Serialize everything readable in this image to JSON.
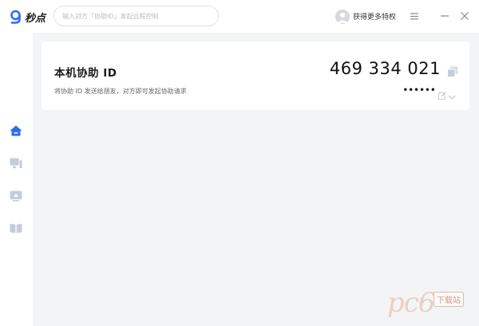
{
  "app": {
    "name": "秒点"
  },
  "search": {
    "placeholder": "输入对方「协助ID」发起远程控制"
  },
  "user": {
    "label": "获得更多特权"
  },
  "card": {
    "title": "本机协助 ID",
    "subtitle": "将协助 ID 发送给朋友，对方即可发起协助请求",
    "assist_id": "469 334 021",
    "password_masked": "••••••"
  },
  "watermark": {
    "text": "pc6",
    "badge": "下载站"
  },
  "colors": {
    "accent": "#2f6cf6",
    "sidebar_icon": "#c6ccd6",
    "background": "#f3f4f6"
  },
  "icons": {
    "home": "home-icon",
    "device": "device-icon",
    "screen": "screen-icon",
    "book": "book-icon",
    "menu": "menu-icon",
    "minimize": "minimize-icon",
    "close": "close-icon",
    "copy": "copy-icon",
    "edit": "edit-icon",
    "dropdown": "chevron-down-icon"
  }
}
